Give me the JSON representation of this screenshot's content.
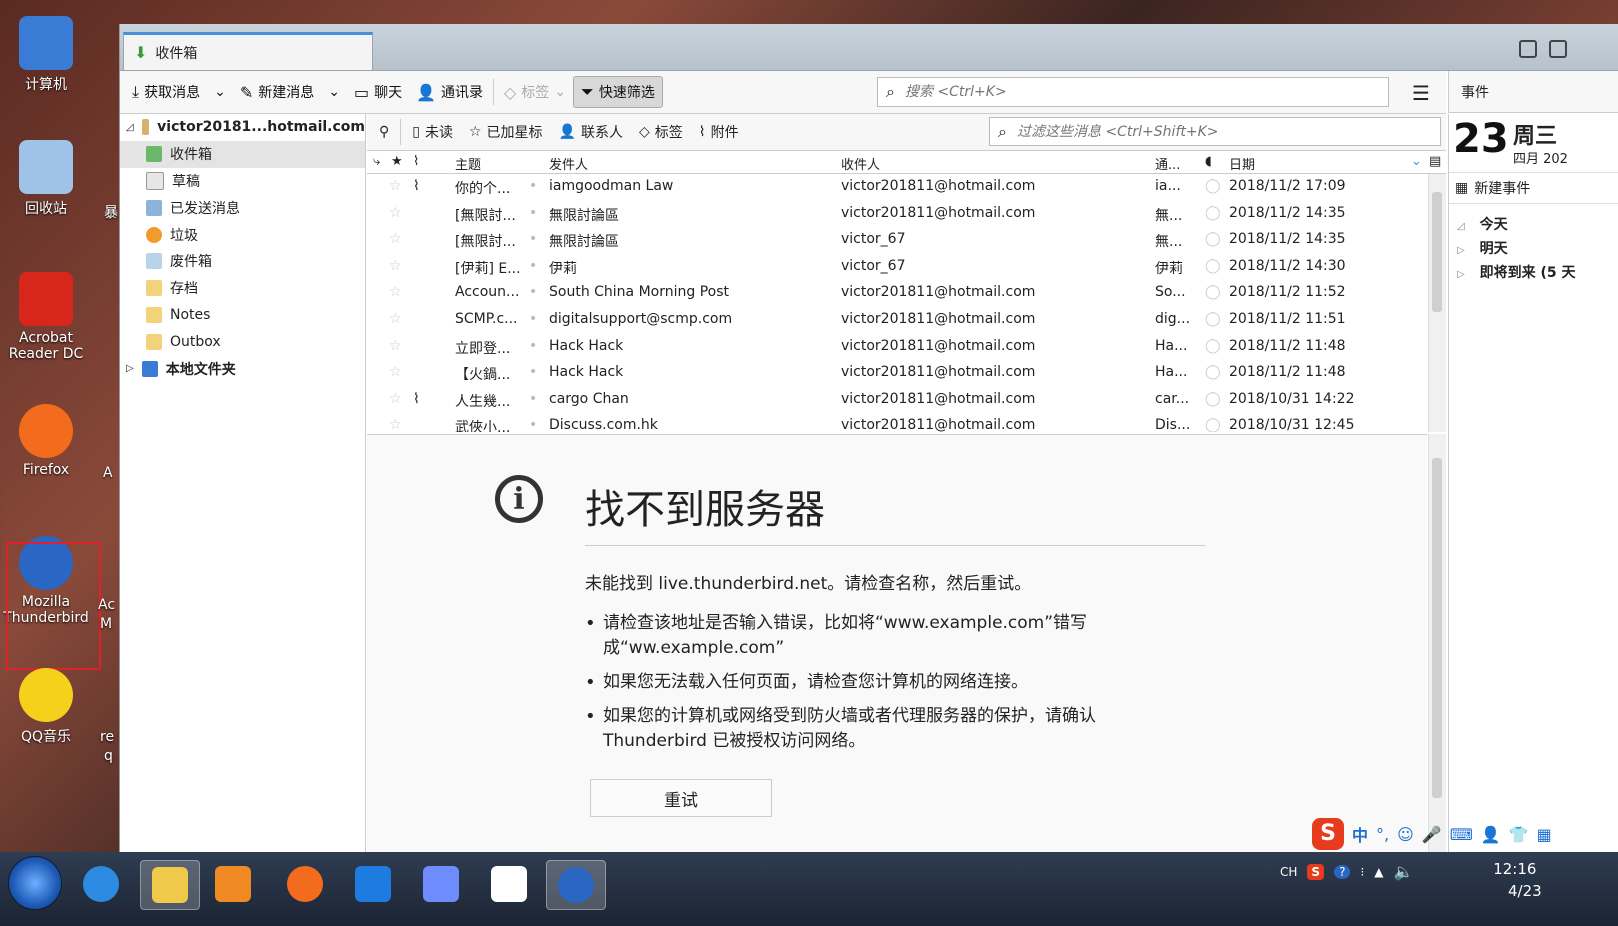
{
  "desktop": {
    "icons": [
      {
        "label": "计算机",
        "color": "#3a7bd5"
      },
      {
        "label": "回收站",
        "color": "#9fc3e8"
      },
      {
        "label": "Acrobat Reader DC",
        "color": "#d8261c"
      },
      {
        "label": "Firefox",
        "color": "#f36b1c"
      },
      {
        "label": "Mozilla Thunderbird",
        "color": "#2a66c4"
      },
      {
        "label": "QQ音乐",
        "color": "#f5d11b"
      }
    ],
    "partials": [
      "暴",
      "A",
      "Ac",
      "M",
      "re",
      "q"
    ]
  },
  "window": {
    "tab_title": "收件箱"
  },
  "toolbar": {
    "get_messages": "获取消息",
    "write": "新建消息",
    "chat": "聊天",
    "address_book": "通讯录",
    "tag": "标签",
    "quick_filter": "快速筛选",
    "search_placeholder": "搜索 <Ctrl+K>"
  },
  "calendar_header": "事件",
  "folders": {
    "account": "victor20181...hotmail.com",
    "items": [
      "收件箱",
      "草稿",
      "已发送消息",
      "垃圾",
      "废件箱",
      "存档",
      "Notes",
      "Outbox"
    ],
    "local": "本地文件夹"
  },
  "filterbar": {
    "unread": "未读",
    "starred": "已加星标",
    "contact": "联系人",
    "tags": "标签",
    "attachment": "附件",
    "placeholder": "过滤这些消息 <Ctrl+Shift+K>"
  },
  "columns": {
    "subject": "主题",
    "from": "发件人",
    "recipient": "收件人",
    "correspondents": "通...",
    "date": "日期"
  },
  "messages": [
    {
      "subject": "你的个...",
      "from": "iamgoodman Law",
      "to": "victor201811@hotmail.com",
      "corr": "ia...",
      "date": "2018/11/2 17:09",
      "attach": true
    },
    {
      "subject": "[無限討...",
      "from": "無限討論區",
      "to": "victor201811@hotmail.com",
      "corr": "無...",
      "date": "2018/11/2 14:35",
      "attach": false
    },
    {
      "subject": "[無限討...",
      "from": "無限討論區",
      "to": "victor_67",
      "corr": "無...",
      "date": "2018/11/2 14:35",
      "attach": false
    },
    {
      "subject": "[伊莉] E...",
      "from": "伊莉",
      "to": "victor_67",
      "corr": "伊莉",
      "date": "2018/11/2 14:30",
      "attach": false
    },
    {
      "subject": "Accoun...",
      "from": "South China Morning Post",
      "to": "victor201811@hotmail.com",
      "corr": "So...",
      "date": "2018/11/2 11:52",
      "attach": false
    },
    {
      "subject": "SCMP.c...",
      "from": "digitalsupport@scmp.com",
      "to": "victor201811@hotmail.com",
      "corr": "dig...",
      "date": "2018/11/2 11:51",
      "attach": false
    },
    {
      "subject": "立即登...",
      "from": "Hack Hack",
      "to": "victor201811@hotmail.com",
      "corr": "Ha...",
      "date": "2018/11/2 11:48",
      "attach": false
    },
    {
      "subject": "【火鍋...",
      "from": "Hack Hack",
      "to": "victor201811@hotmail.com",
      "corr": "Ha...",
      "date": "2018/11/2 11:48",
      "attach": false
    },
    {
      "subject": "人生幾...",
      "from": "cargo Chan",
      "to": "victor201811@hotmail.com",
      "corr": "car...",
      "date": "2018/10/31 14:22",
      "attach": true
    },
    {
      "subject": "武俠小...",
      "from": "Discuss.com.hk",
      "to": "victor201811@hotmail.com",
      "corr": "Dis...",
      "date": "2018/10/31 12:45",
      "attach": false
    }
  ],
  "error": {
    "title": "找不到服务器",
    "description": "未能找到 live.thunderbird.net。请检查名称，然后重试。",
    "bullets": [
      "请检查该地址是否输入错误，比如将“www.example.com”错写成“ww.example.com”",
      "如果您无法载入任何页面，请检查您计算机的网络连接。",
      "如果您的计算机或网络受到防火墙或者代理服务器的保护，请确认 Thunderbird 已被授权访问网络。"
    ],
    "retry": "重试"
  },
  "calendar": {
    "day": "23",
    "weekday": "周三",
    "month": "四月 202",
    "new_event": "新建事件",
    "today": "今天",
    "tomorrow": "明天",
    "upcoming": "即将到来 (5 天"
  },
  "ime": {
    "logo": "S",
    "mode": "中"
  },
  "tray": {
    "lang": "CH",
    "time": "12:16",
    "date": "4/23"
  }
}
